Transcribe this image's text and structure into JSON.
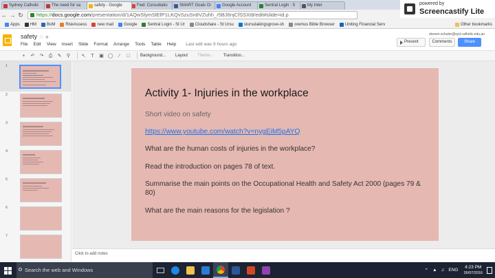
{
  "browser": {
    "tabs": [
      {
        "label": "Sydney Catholic",
        "color": "#c0392b"
      },
      {
        "label": "The need for sa",
        "color": "#c0392b"
      },
      {
        "label": "safety - Google",
        "color": "#f4b400",
        "active": true
      },
      {
        "label": "Fwd: Consultatio",
        "color": "#d44638"
      },
      {
        "label": "SMART Goals Oi",
        "color": "#3b5998"
      },
      {
        "label": "Google Account",
        "color": "#4285f4"
      },
      {
        "label": "Sentral Login : S",
        "color": "#2e7d32"
      },
      {
        "label": "My Inter",
        "color": "#555"
      }
    ],
    "url_prefix": "https://",
    "url_host": "docs.google.com",
    "url_path": "/presentation/d/1AQwSlymSlEfP1LKQvSzuSn8VZuhh_r5BJ6njCfSSXt8/edit#slide=id.p",
    "bookmarks": [
      {
        "label": "Apps",
        "color": "#4285f4"
      },
      {
        "label": "HM",
        "color": "#333"
      },
      {
        "label": "BoM",
        "color": "#2a6ab0"
      },
      {
        "label": "RiskAssess",
        "color": "#e67e22"
      },
      {
        "label": "new mail",
        "color": "#d44638"
      },
      {
        "label": "Google",
        "color": "#4285f4"
      },
      {
        "label": "Sentral Login - St Ur",
        "color": "#2e7d32"
      },
      {
        "label": "Cloudshare - St Ursu",
        "color": "#888"
      },
      {
        "label": "stursulakingsgrove-sh",
        "color": "#0078d4"
      },
      {
        "label": "oremus Bible Browser",
        "color": "#888"
      },
      {
        "label": "Uniting Financial Serv",
        "color": "#1565c0"
      }
    ],
    "other_bookmarks": "Other bookmarks"
  },
  "screencastify": {
    "small": "powered by",
    "big": "Screencastify Lite"
  },
  "docs": {
    "title": "safety",
    "menu": [
      "File",
      "Edit",
      "View",
      "Insert",
      "Slide",
      "Format",
      "Arrange",
      "Tools",
      "Table",
      "Help"
    ],
    "last_edit": "Last edit was 9 hours ago",
    "email": "doreen.schuler@syd.catholic.edu.au",
    "present": "Present",
    "comments": "Comments",
    "share": "Share",
    "toolbar": {
      "background": "Background...",
      "layout": "Layout",
      "theme": "Theme...",
      "transition": "Transition..."
    }
  },
  "slide": {
    "title": "Activity 1- Injuries in the workplace",
    "lines": [
      "Short video on safety",
      "https://www.youtube.com/watch?v=nygEiM5pAYQ",
      "What are the human costs of injuries in the workplace?",
      "Read the introduction on pages 78 of text.",
      "Summarise the main points on the Occupational Health and Safety Act 2000 (pages 79 & 80)",
      "What are the main reasons for the legislation ?"
    ]
  },
  "filmstrip": {
    "numbers": [
      "1",
      "2",
      "3",
      "4",
      "5",
      "6",
      "7"
    ]
  },
  "notes": "Click to add notes",
  "taskbar": {
    "search": "Search the web and Windows",
    "lang": "ENG",
    "time": "4:23 PM",
    "date": "26/07/2016"
  }
}
